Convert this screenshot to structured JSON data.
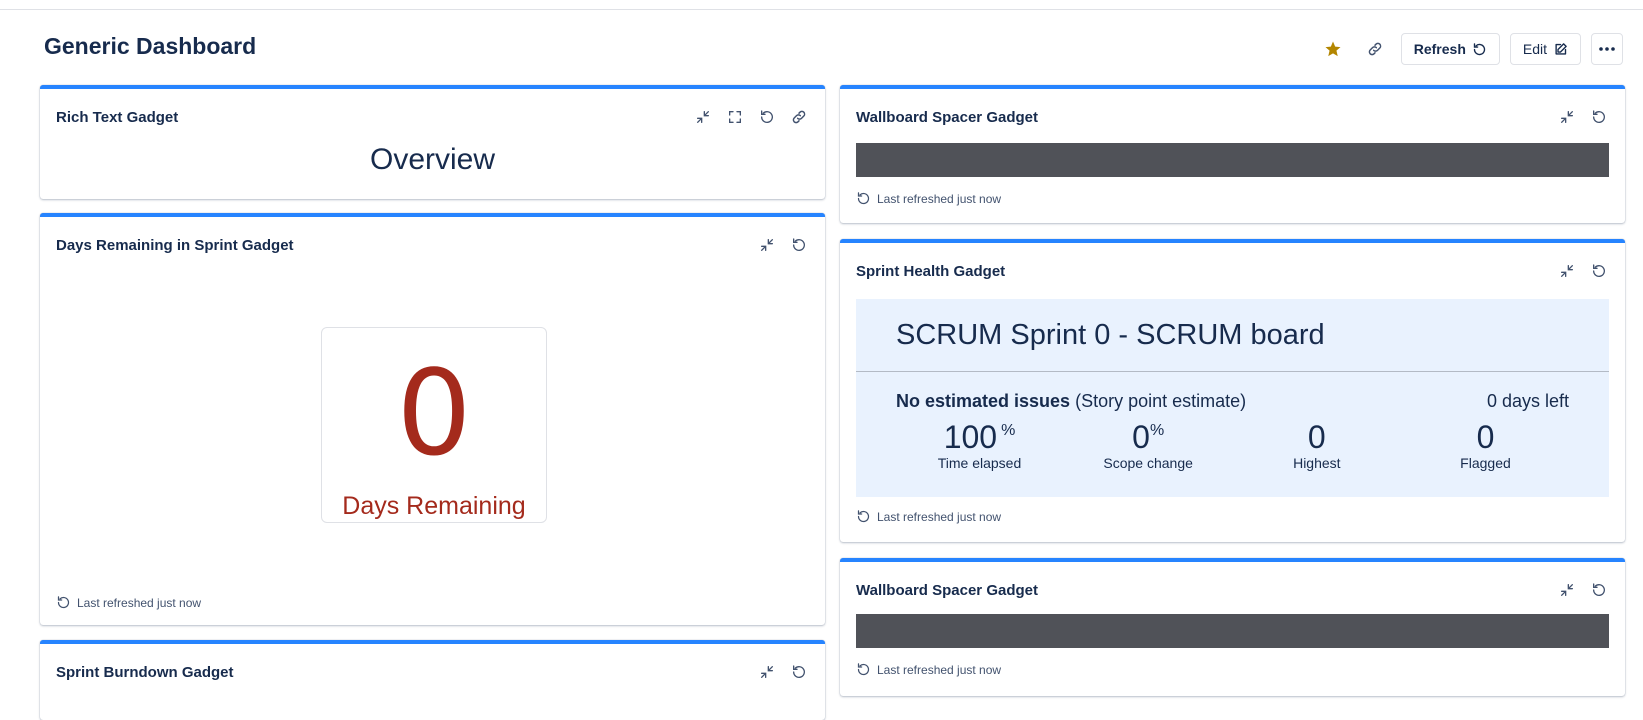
{
  "page": {
    "title": "Generic Dashboard"
  },
  "header": {
    "refresh_label": "Refresh",
    "edit_label": "Edit",
    "star_color": "#b38600"
  },
  "gadgets": {
    "rich_text": {
      "title": "Rich Text Gadget",
      "content": "Overview"
    },
    "days_remaining": {
      "title": "Days Remaining in Sprint Gadget",
      "value": "0",
      "label": "Days Remaining",
      "refreshed": "Last refreshed just now"
    },
    "burndown": {
      "title": "Sprint Burndown Gadget"
    },
    "spacer_top": {
      "title": "Wallboard Spacer Gadget",
      "refreshed": "Last refreshed just now"
    },
    "sprint_health": {
      "title": "Sprint Health Gadget",
      "sprint_name": "SCRUM Sprint 0 - SCRUM board",
      "estimate_bold": "No estimated issues",
      "estimate_rest": " (Story point estimate)",
      "days_left": "0 days left",
      "metrics": [
        {
          "value": "100",
          "unit": "%",
          "label": "Time elapsed"
        },
        {
          "value": "0",
          "unit": "%",
          "label": "Scope change"
        },
        {
          "value": "0",
          "unit": "",
          "label": "Highest"
        },
        {
          "value": "0",
          "unit": "",
          "label": "Flagged"
        }
      ],
      "refreshed": "Last refreshed just now"
    },
    "spacer_bottom": {
      "title": "Wallboard Spacer Gadget",
      "refreshed": "Last refreshed just now"
    }
  },
  "colors": {
    "accent": "#2684ff",
    "days_red": "#a42a1c",
    "spacer": "#505258",
    "health_bg": "#e9f2fe"
  }
}
